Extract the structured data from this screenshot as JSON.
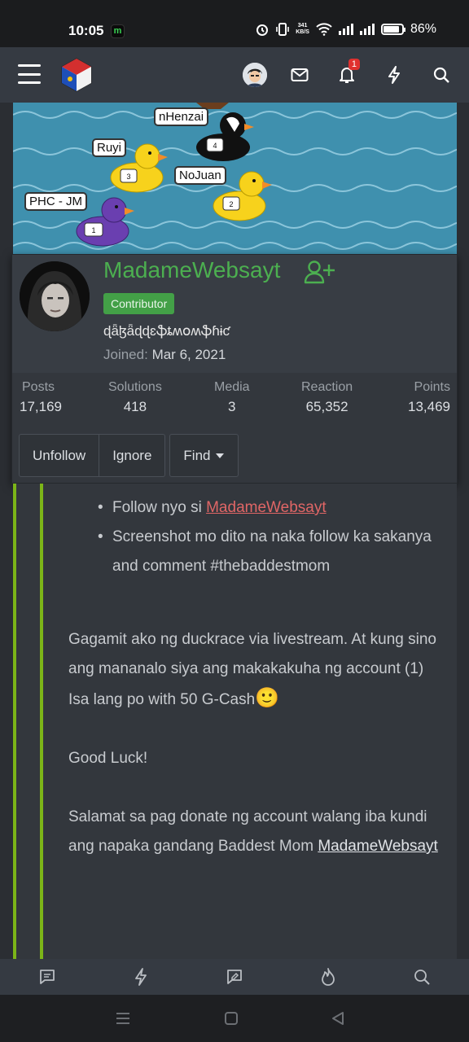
{
  "status": {
    "time": "10:05",
    "net_speed": "341",
    "net_unit": "KB/S",
    "battery": "86%"
  },
  "nav": {
    "notification_count": "1"
  },
  "banner": {
    "ducks": [
      "nHenzai",
      "Ruyi",
      "NoJuan",
      "PHC - JM"
    ],
    "numbers": [
      "4",
      "3",
      "2",
      "1"
    ]
  },
  "profile": {
    "username": "MadameWebsayt",
    "role": "Contributor",
    "custom_title": "ɖǟɮǟɖɖɛֆȶʍօʍֆɦɨƈ",
    "joined_label": "Joined:",
    "joined_value": "Mar 6, 2021",
    "stats": [
      {
        "label": "Posts",
        "value": "17,169"
      },
      {
        "label": "Solutions",
        "value": "418"
      },
      {
        "label": "Media",
        "value": "3"
      },
      {
        "label": "Reaction",
        "value": "65,352"
      },
      {
        "label": "Points",
        "value": "13,469"
      }
    ],
    "actions": {
      "unfollow": "Unfollow",
      "ignore": "Ignore",
      "find": "Find"
    }
  },
  "post": {
    "bullet1_text": "Follow nyo si ",
    "bullet1_link": "MadameWebsayt",
    "bullet2": "Screenshot mo dito na naka follow ka sakanya and comment #thebaddestmom",
    "para1": "Gagamit ako ng duckrace via livestream. At kung sino ang mananalo siya ang makakakuha ng account (1) Isa lang po with 50 G-Cash",
    "emoji": "🙂",
    "para2": "Good Luck!",
    "para3_text": "Salamat sa pag donate ng account walang iba kundi ang napaka gandang Baddest Mom ",
    "para3_link": "MadameWebsayt"
  },
  "colors": {
    "accent_green": "#4caf50",
    "bar_green": "#7cb518",
    "mention_red": "#e06666"
  }
}
